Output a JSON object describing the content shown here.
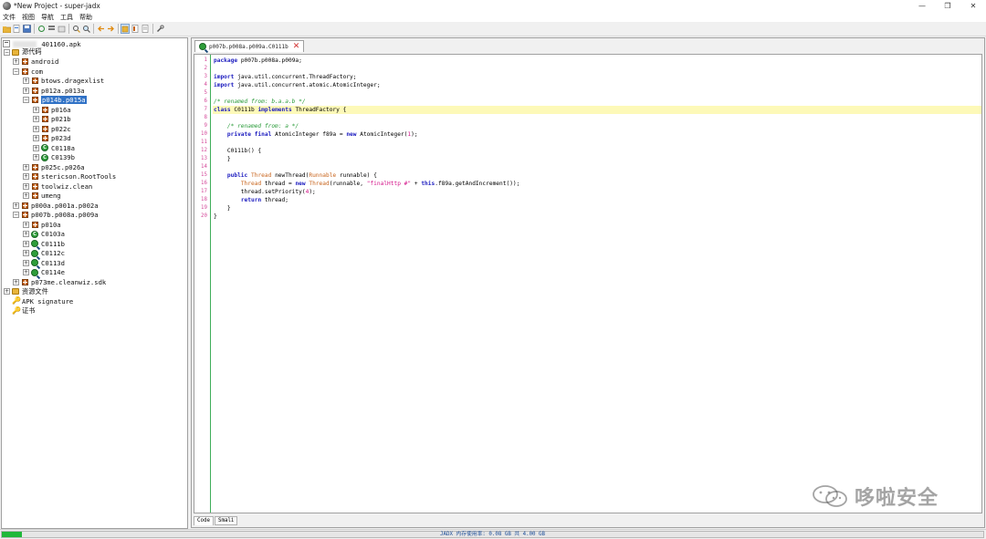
{
  "window": {
    "title": "*New Project - super-jadx",
    "controls": [
      "—",
      "❐",
      "✕"
    ]
  },
  "menu": [
    "文件",
    "视图",
    "导航",
    "工具",
    "帮助"
  ],
  "tree": {
    "root_suffix": "_401160.apk",
    "items": [
      {
        "label": "源代码",
        "icon": "folder"
      },
      {
        "label": "android",
        "icon": "package"
      },
      {
        "label": "com",
        "icon": "package"
      },
      {
        "label": "btows.dragexlist",
        "icon": "package"
      },
      {
        "label": "p012a.p013a",
        "icon": "package"
      },
      {
        "label": "p014b.p015a",
        "icon": "package",
        "selected": true
      },
      {
        "label": "p016a",
        "icon": "package"
      },
      {
        "label": "p021b",
        "icon": "package"
      },
      {
        "label": "p022c",
        "icon": "package"
      },
      {
        "label": "p023d",
        "icon": "package"
      },
      {
        "label": "C0118a",
        "icon": "class"
      },
      {
        "label": "C0139b",
        "icon": "class"
      },
      {
        "label": "p025c.p026a",
        "icon": "package"
      },
      {
        "label": "stericson.RootTools",
        "icon": "package"
      },
      {
        "label": "toolwiz.clean",
        "icon": "package"
      },
      {
        "label": "umeng",
        "icon": "package"
      },
      {
        "label": "p000a.p001a.p002a",
        "icon": "package"
      },
      {
        "label": "p007b.p008a.p009a",
        "icon": "package"
      },
      {
        "label": "p010a",
        "icon": "package"
      },
      {
        "label": "C0103a",
        "icon": "class"
      },
      {
        "label": "C0111b",
        "icon": "class-search"
      },
      {
        "label": "C0112c",
        "icon": "class-search"
      },
      {
        "label": "C0113d",
        "icon": "class-search"
      },
      {
        "label": "C0114e",
        "icon": "class-search"
      },
      {
        "label": "p073me.cleanwiz.sdk",
        "icon": "package"
      },
      {
        "label": "资源文件",
        "icon": "folder"
      },
      {
        "label": "APK signature",
        "icon": "key"
      },
      {
        "label": "证书",
        "icon": "key"
      }
    ]
  },
  "editor": {
    "tab_label": "p007b.p008a.p009a.C0111b",
    "line_numbers": [
      "1",
      "2",
      "3",
      "4",
      "5",
      "6",
      "7",
      "8",
      "9",
      "10",
      "11",
      "12",
      "13",
      "14",
      "15",
      "16",
      "17",
      "18",
      "19",
      "20"
    ],
    "code": [
      "package p007b.p008a.p009a;",
      "",
      "import java.util.concurrent.ThreadFactory;",
      "import java.util.concurrent.atomic.AtomicInteger;",
      "",
      "/* renamed from: b.a.a.b */",
      "class C0111b implements ThreadFactory {",
      "",
      "    /* renamed from: a */",
      "    private final AtomicInteger f89a = new AtomicInteger(1);",
      "",
      "    C0111b() {",
      "    }",
      "",
      "    public Thread newThread(Runnable runnable) {",
      "        Thread thread = new Thread(runnable, \"finalHttp #\" + this.f89a.getAndIncrement());",
      "        thread.setPriority(4);",
      "        return thread;",
      "    }",
      "}"
    ],
    "bottom_tabs": [
      "Code",
      "Smali"
    ]
  },
  "status": {
    "memory_text": "JADX 内存使用率: 0.08 GB 共 4.00 GB",
    "memory_fraction": 0.02,
    "fill_color": "#1fb839"
  },
  "watermark": {
    "text": "哆啦安全"
  }
}
